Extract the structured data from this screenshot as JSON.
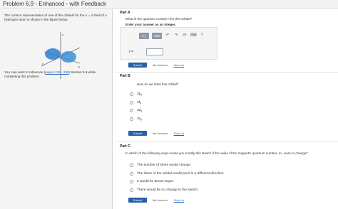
{
  "header": {
    "title": "Problem 6.9 - Enhanced - with Feedback"
  },
  "left": {
    "intro": "The contour representation of one of the orbitals for the n = 3 shell of a hydrogen atom is shown in the figure below.",
    "axis_labels": {
      "z": "z",
      "x": "x",
      "y": "y"
    },
    "ref_prefix": "You may want to reference (",
    "ref_link": "pages 232 - 235",
    "ref_suffix": ") Section 6.6 while completing this problem."
  },
  "partA": {
    "label": "Part A",
    "question": "What is the quantum number ℓ for this orbital?",
    "instruction": "Enter your answer as an integer.",
    "toolbar": {
      "templates": "√▢",
      "greek": "ΑΣΦ",
      "undo_icon": "undo-icon",
      "redo_icon": "redo-icon",
      "reset_icon": "reset-icon",
      "keyboard_icon": "keyboard-icon",
      "help": "?"
    },
    "field_label": "ℓ =",
    "submit": "Submit",
    "my_answers": "My Answers",
    "give_up": "Give Up"
  },
  "partB": {
    "label": "Part B",
    "question": "How do we label this orbital?",
    "options": [
      "3p",
      "3f",
      "3d",
      "3s"
    ],
    "option_subs": [
      "y",
      "y",
      "y",
      "y"
    ],
    "submit": "Submit",
    "my_answers": "My Answers",
    "give_up": "Give Up"
  },
  "partC": {
    "label": "Part C",
    "question": "In which of the following ways would you modify this sketch if the value of the magnetic quantum number, mₗ, were to change?",
    "options": [
      "The number of lobes would change.",
      "The lobes of the orbital would point in a different direction.",
      "It would be drawn larger.",
      "There would be no change in the sketch."
    ],
    "submit": "Submit",
    "my_answers": "My Answers",
    "give_up": "Give Up"
  }
}
